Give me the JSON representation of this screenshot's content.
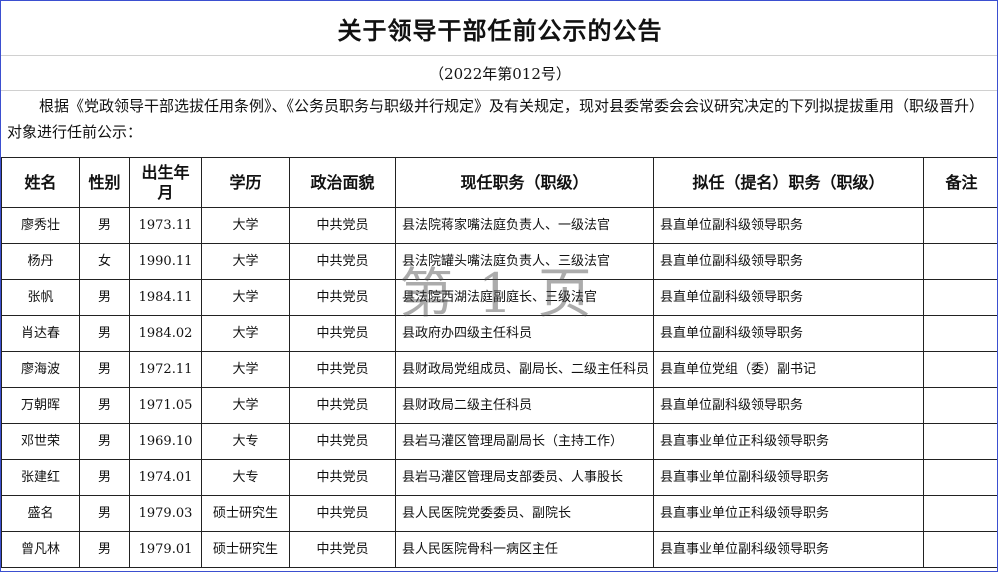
{
  "document": {
    "title": "关于领导干部任前公示的公告",
    "number": "（2022年第012号）",
    "intro": "根据《党政领导干部选拔任用条例》、《公务员职务与职级并行规定》及有关规定，现对县委常委会会议研究决定的下列拟提拔重用（职级晋升）对象进行任前公示："
  },
  "table": {
    "headers": [
      "姓名",
      "性别",
      "出生年月",
      "学历",
      "政治面貌",
      "现任职务（职级）",
      "拟任（提名）职务（职级）",
      "备注"
    ],
    "rows": [
      [
        "廖秀壮",
        "男",
        "1973.11",
        "大学",
        "中共党员",
        "县法院蒋家嘴法庭负责人、一级法官",
        "县直单位副科级领导职务",
        ""
      ],
      [
        "杨丹",
        "女",
        "1990.11",
        "大学",
        "中共党员",
        "县法院罐头嘴法庭负责人、三级法官",
        "县直单位副科级领导职务",
        ""
      ],
      [
        "张帆",
        "男",
        "1984.11",
        "大学",
        "中共党员",
        "县法院西湖法庭副庭长、三级法官",
        "县直单位副科级领导职务",
        ""
      ],
      [
        "肖达春",
        "男",
        "1984.02",
        "大学",
        "中共党员",
        "县政府办四级主任科员",
        "县直单位副科级领导职务",
        ""
      ],
      [
        "廖海波",
        "男",
        "1972.11",
        "大学",
        "中共党员",
        "县财政局党组成员、副局长、二级主任科员",
        "县直单位党组（委）副书记",
        ""
      ],
      [
        "万朝晖",
        "男",
        "1971.05",
        "大学",
        "中共党员",
        "县财政局二级主任科员",
        "县直单位副科级领导职务",
        ""
      ],
      [
        "邓世荣",
        "男",
        "1969.10",
        "大专",
        "中共党员",
        "县岩马灌区管理局副局长（主持工作）",
        "县直事业单位正科级领导职务",
        ""
      ],
      [
        "张建红",
        "男",
        "1974.01",
        "大专",
        "中共党员",
        "县岩马灌区管理局支部委员、人事股长",
        "县直事业单位副科级领导职务",
        ""
      ],
      [
        "盛名",
        "男",
        "1979.03",
        "硕士研究生",
        "中共党员",
        "县人民医院党委委员、副院长",
        "县直事业单位正科级领导职务",
        ""
      ],
      [
        "曾凡林",
        "男",
        "1979.01",
        "硕士研究生",
        "中共党员",
        "县人民医院骨科一病区主任",
        "县直事业单位副科级领导职务",
        ""
      ]
    ]
  },
  "watermark": "第 1 页",
  "colors": {
    "frame": "#3b4fd0",
    "grid": "#222222",
    "watermark": "#464646"
  }
}
